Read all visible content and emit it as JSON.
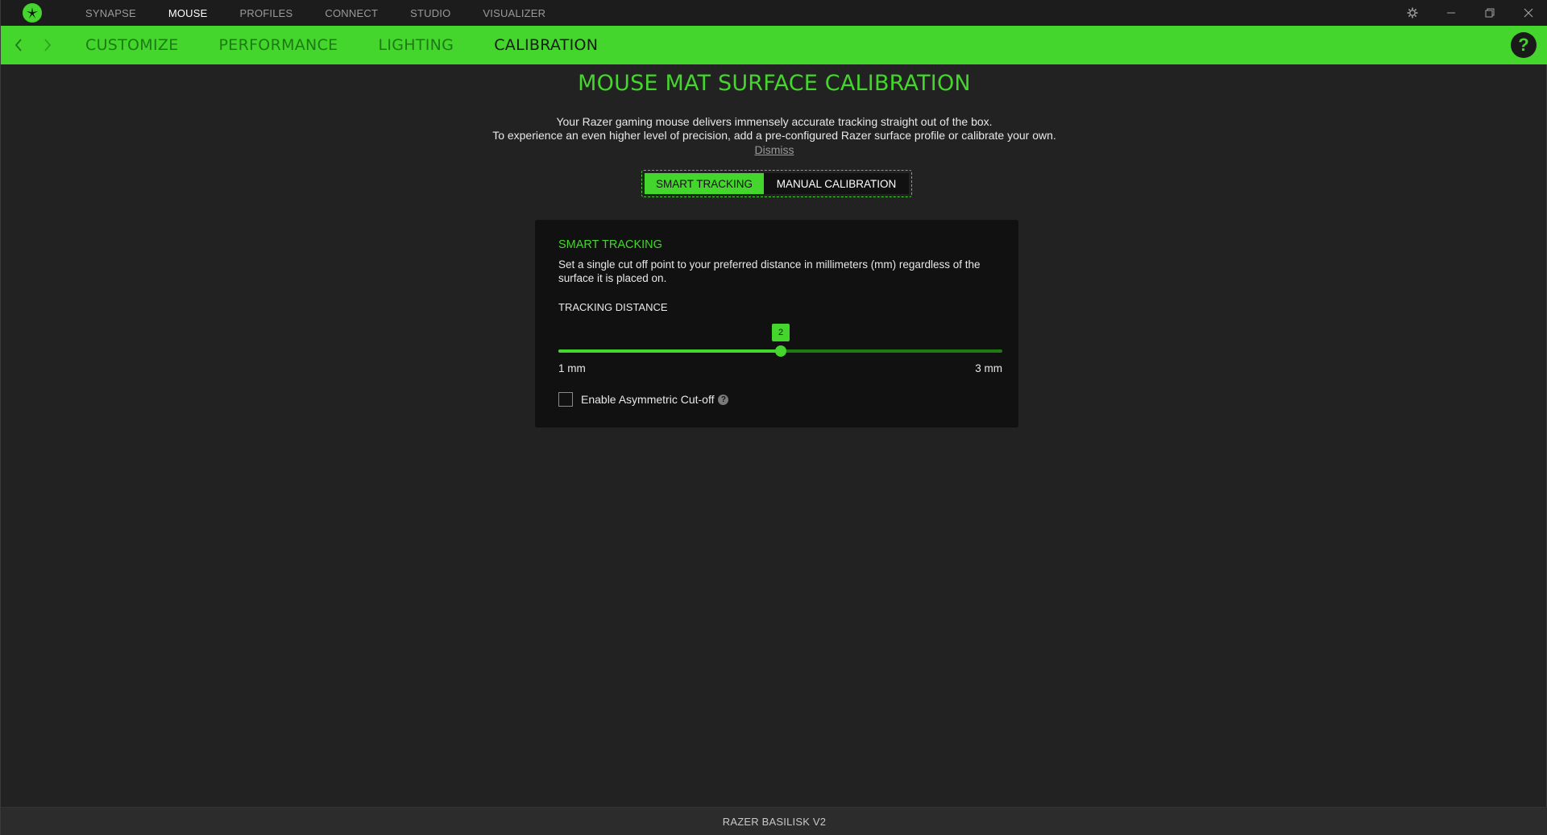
{
  "top_nav": {
    "items": [
      {
        "label": "SYNAPSE"
      },
      {
        "label": "MOUSE",
        "active": true
      },
      {
        "label": "PROFILES"
      },
      {
        "label": "CONNECT"
      },
      {
        "label": "STUDIO"
      },
      {
        "label": "VISUALIZER"
      }
    ]
  },
  "sub_nav": {
    "tabs": [
      {
        "label": "CUSTOMIZE"
      },
      {
        "label": "PERFORMANCE"
      },
      {
        "label": "LIGHTING"
      },
      {
        "label": "CALIBRATION",
        "active": true
      }
    ]
  },
  "help": {
    "label": "?"
  },
  "page": {
    "title": "MOUSE MAT SURFACE CALIBRATION",
    "intro_line1": "Your Razer gaming mouse delivers immensely accurate tracking straight out of the box.",
    "intro_line2": "To experience an even higher level of precision, add a pre-configured Razer surface profile or calibrate your own.",
    "dismiss": "Dismiss"
  },
  "mode_toggle": {
    "smart": "SMART TRACKING",
    "manual": "MANUAL CALIBRATION",
    "selected": "smart"
  },
  "card": {
    "title": "SMART TRACKING",
    "description": "Set a single cut off point to your preferred distance in millimeters (mm) regardless of the surface it is placed on.",
    "tracking_label": "TRACKING DISTANCE",
    "slider": {
      "min": 1,
      "max": 3,
      "value": 2,
      "value_label": "2",
      "min_label": "1 mm",
      "max_label": "3 mm"
    },
    "asymmetric_label": "Enable Asymmetric Cut-off",
    "asymmetric_checked": false,
    "info_glyph": "?"
  },
  "footer": {
    "device": "RAZER BASILISK V2"
  },
  "colors": {
    "accent": "#44d62c",
    "background": "#222222",
    "panel": "#111111"
  }
}
